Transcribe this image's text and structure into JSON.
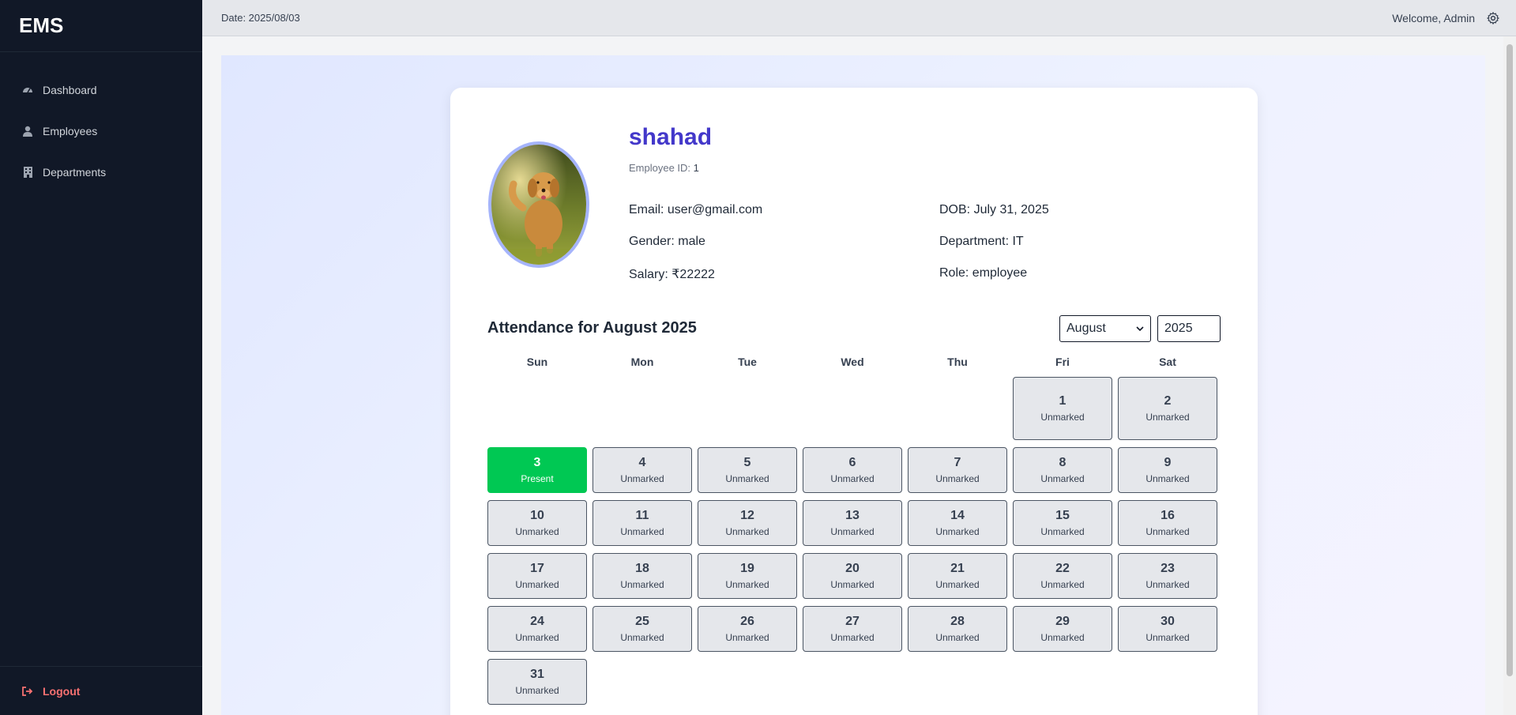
{
  "app": {
    "brand": "EMS"
  },
  "sidebar": {
    "items": [
      {
        "label": "Dashboard",
        "icon": "dashboard-icon"
      },
      {
        "label": "Employees",
        "icon": "user-icon"
      },
      {
        "label": "Departments",
        "icon": "building-icon"
      }
    ],
    "logout_label": "Logout"
  },
  "topbar": {
    "date": "Date: 2025/08/03",
    "welcome": "Welcome, Admin"
  },
  "profile": {
    "name": "shahad",
    "employee_id_label": "Employee ID:",
    "employee_id": "1",
    "email": "Email: user@gmail.com",
    "dob": "DOB: July 31, 2025",
    "gender": "Gender: male",
    "department": "Department: IT",
    "salary": "Salary: ₹22222",
    "role": "Role: employee"
  },
  "attendance": {
    "title": "Attendance for August 2025",
    "month_selected": "August",
    "year_value": "2025",
    "weekdays": [
      "Sun",
      "Mon",
      "Tue",
      "Wed",
      "Thu",
      "Fri",
      "Sat"
    ],
    "leading_blanks": 5,
    "days": [
      {
        "day": "1",
        "status": "Unmarked"
      },
      {
        "day": "2",
        "status": "Unmarked"
      },
      {
        "day": "3",
        "status": "Present"
      },
      {
        "day": "4",
        "status": "Unmarked"
      },
      {
        "day": "5",
        "status": "Unmarked"
      },
      {
        "day": "6",
        "status": "Unmarked"
      },
      {
        "day": "7",
        "status": "Unmarked"
      },
      {
        "day": "8",
        "status": "Unmarked"
      },
      {
        "day": "9",
        "status": "Unmarked"
      },
      {
        "day": "10",
        "status": "Unmarked"
      },
      {
        "day": "11",
        "status": "Unmarked"
      },
      {
        "day": "12",
        "status": "Unmarked"
      },
      {
        "day": "13",
        "status": "Unmarked"
      },
      {
        "day": "14",
        "status": "Unmarked"
      },
      {
        "day": "15",
        "status": "Unmarked"
      },
      {
        "day": "16",
        "status": "Unmarked"
      },
      {
        "day": "17",
        "status": "Unmarked"
      },
      {
        "day": "18",
        "status": "Unmarked"
      },
      {
        "day": "19",
        "status": "Unmarked"
      },
      {
        "day": "20",
        "status": "Unmarked"
      },
      {
        "day": "21",
        "status": "Unmarked"
      },
      {
        "day": "22",
        "status": "Unmarked"
      },
      {
        "day": "23",
        "status": "Unmarked"
      },
      {
        "day": "24",
        "status": "Unmarked"
      },
      {
        "day": "25",
        "status": "Unmarked"
      },
      {
        "day": "26",
        "status": "Unmarked"
      },
      {
        "day": "27",
        "status": "Unmarked"
      },
      {
        "day": "28",
        "status": "Unmarked"
      },
      {
        "day": "29",
        "status": "Unmarked"
      },
      {
        "day": "30",
        "status": "Unmarked"
      },
      {
        "day": "31",
        "status": "Unmarked"
      }
    ]
  },
  "colors": {
    "sidebar_bg": "#111827",
    "accent": "#4338ca",
    "present": "#00c853",
    "logout": "#f87171"
  }
}
